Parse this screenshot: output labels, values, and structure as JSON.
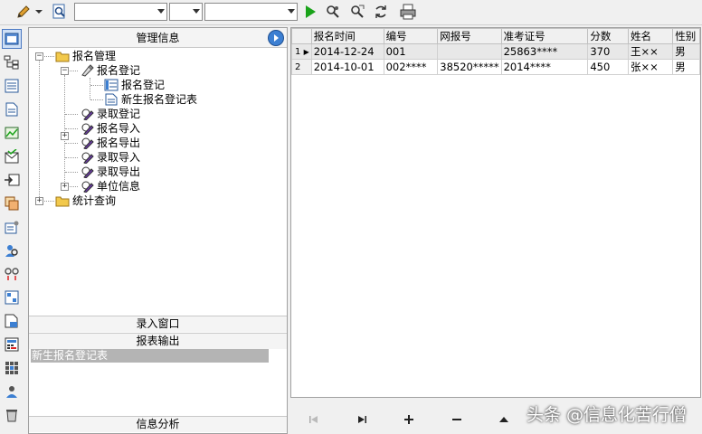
{
  "toolbar": {
    "combo1_value": "",
    "combo2_value": "",
    "combo3_value": ""
  },
  "panel": {
    "title": "管理信息",
    "tree": {
      "root1": "报名管理",
      "reg_group": "报名登记",
      "reg_item": "报名登记",
      "new_table": "新生报名登记表",
      "admit_reg": "录取登记",
      "reg_import": "报名导入",
      "reg_export": "报名导出",
      "admit_import": "录取导入",
      "admit_export": "录取导出",
      "unit_info": "单位信息",
      "root2": "统计查询"
    },
    "entry_window": "录入窗口",
    "report_output": "报表输出",
    "report_items": [
      "新生报名登记表"
    ],
    "info_analysis": "信息分析"
  },
  "grid": {
    "columns": [
      "",
      "报名时间",
      "编号",
      "网报号",
      "准考证号",
      "分数",
      "姓名",
      "性别"
    ],
    "rows": [
      {
        "no": "1",
        "date": "2014-12-24",
        "id": "001",
        "web": "",
        "ticket": "25863****",
        "score": "370",
        "name": "王××",
        "sex": "男"
      },
      {
        "no": "2",
        "date": "2014-10-01",
        "id": "002****",
        "web": "38520*****",
        "ticket": "2014****",
        "score": "450",
        "name": "张××",
        "sex": "男"
      }
    ]
  },
  "watermark": "头条 @信息化苦行僧",
  "colors": {
    "folder": "#f2c94c",
    "accent": "#3c7fd2",
    "green": "#1aa31a"
  }
}
